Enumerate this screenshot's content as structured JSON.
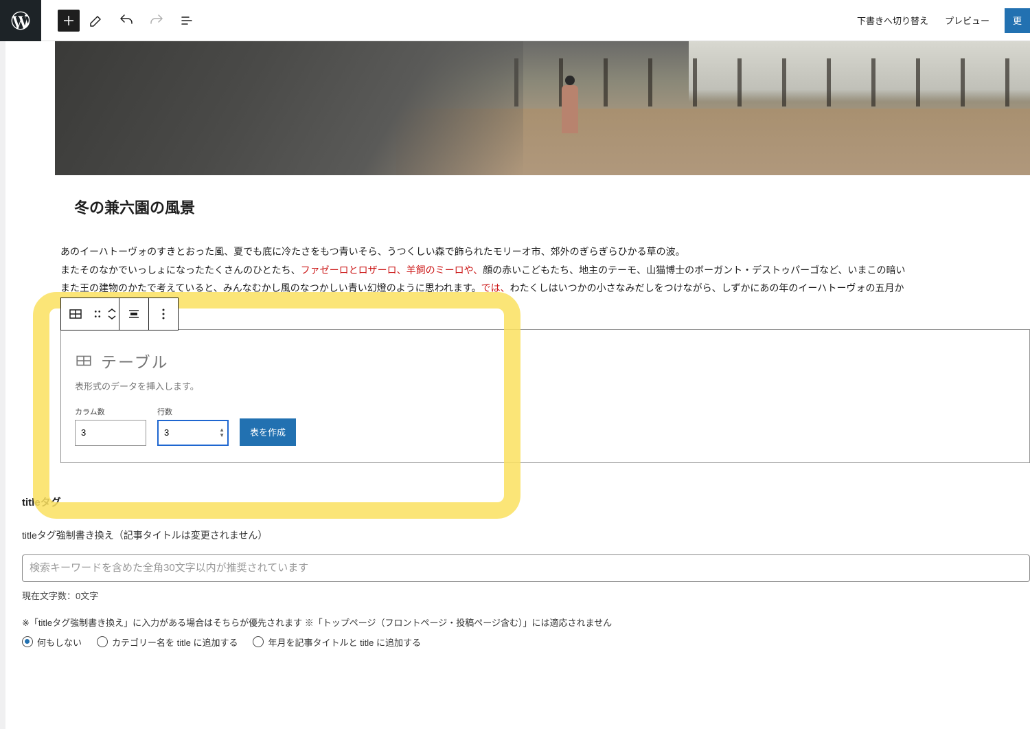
{
  "topbar": {
    "switch_draft": "下書きへ切り替え",
    "preview": "プレビュー",
    "update": "更"
  },
  "post": {
    "heading": "冬の兼六園の風景",
    "para_line1": "あのイーハトーヴォのすきとおった風、夏でも底に冷たさをもつ青いそら、うつくしい森で飾られたモリーオ市、郊外のぎらぎらひかる草の波。",
    "para_line2a": "またそのなかでいっしょになったたくさんのひとたち、",
    "para_highlight": "ファゼーロとロザーロ、羊飼のミーロや、",
    "para_line2b": "顔の赤いこどもたち、地主のテーモ、山猫博士のボーガント・デストゥパーゴなど、いまこの暗い",
    "para_line3a": "また王の建物のかたで考えていると",
    "para_line3b": "、みんなむかし風のなつかしい青い幻燈のように思われます。",
    "para_highlight2": "では、",
    "para_line3c": "わたくしはいつかの小さなみだしをつけながら、しずかにあの年のイーハトーヴォの五月か"
  },
  "table_block": {
    "title": "テーブル",
    "description": "表形式のデータを挿入します。",
    "column_label": "カラム数",
    "column_value": "3",
    "row_label": "行数",
    "row_value": "3",
    "create_button": "表を作成"
  },
  "meta": {
    "section_title": "titleタグ",
    "subheading": "titleタグ強制書き換え（記事タイトルは変更されません）",
    "input_placeholder": "検索キーワードを含めた全角30文字以内が推奨されています",
    "char_count": "現在文字数：0文字",
    "note": "※「titleタグ強制書き換え」に入力がある場合はそちらが優先されます ※「トップページ（フロントページ・投稿ページ含む）」には適応されません",
    "radio1": "何もしない",
    "radio2": "カテゴリー名を title に追加する",
    "radio3": "年月を記事タイトルと title に追加する"
  }
}
